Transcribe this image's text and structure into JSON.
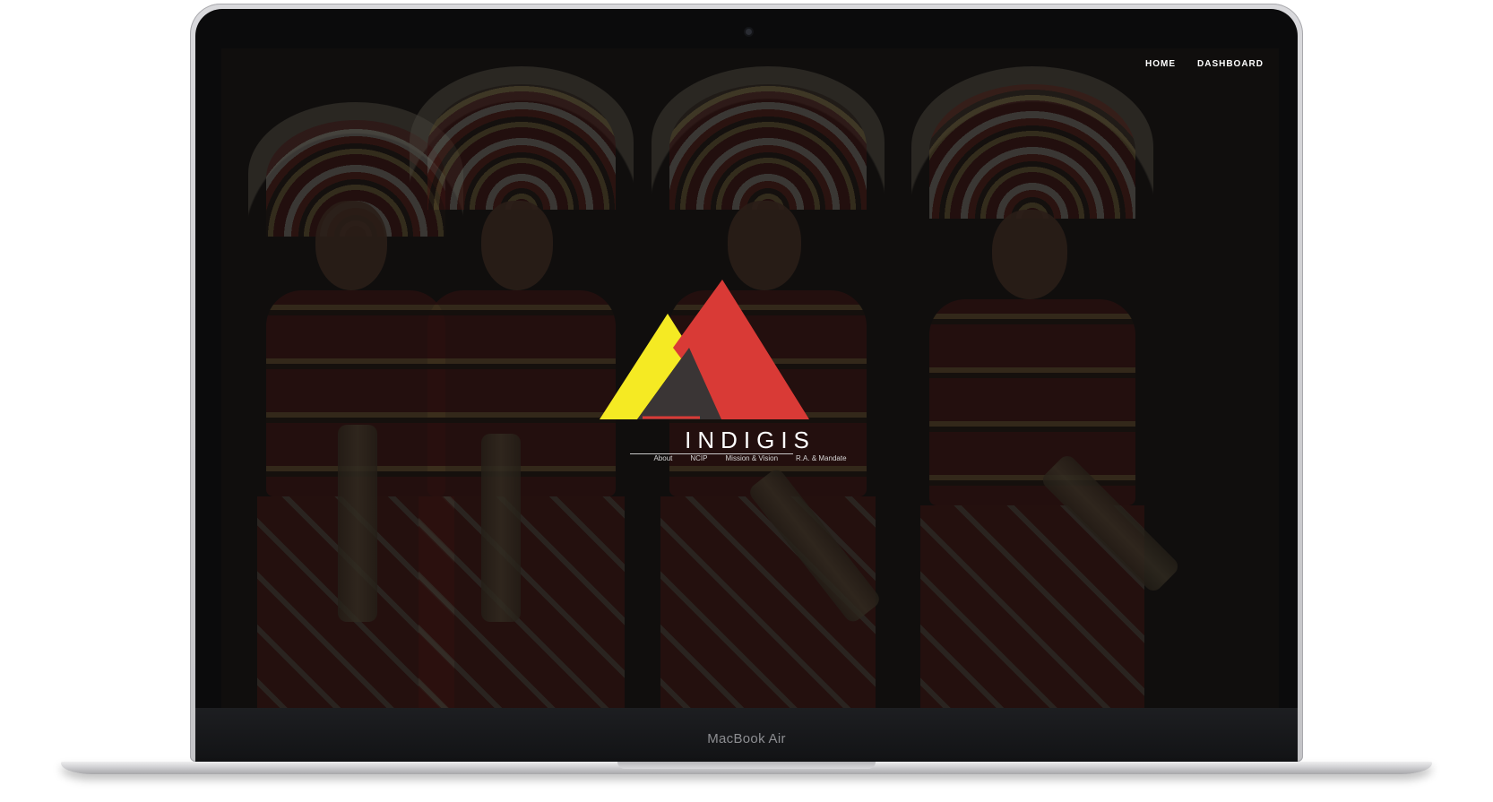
{
  "device": {
    "label": "MacBook Air"
  },
  "site": {
    "name": "INDIGIS",
    "nav": [
      {
        "label": "HOME"
      },
      {
        "label": "DASHBOARD"
      }
    ],
    "links": [
      {
        "label": "About"
      },
      {
        "label": "NCIP"
      },
      {
        "label": "Mission & Vision"
      },
      {
        "label": "R.A. & Mandate"
      }
    ]
  },
  "colors": {
    "logo_yellow": "#f5ea23",
    "logo_red": "#d93a36",
    "logo_dark": "#3a3535",
    "overlay": "#0a0a0a"
  },
  "icons": {
    "logo": "mountain-triangle-logo",
    "camera": "webcam-dot"
  }
}
